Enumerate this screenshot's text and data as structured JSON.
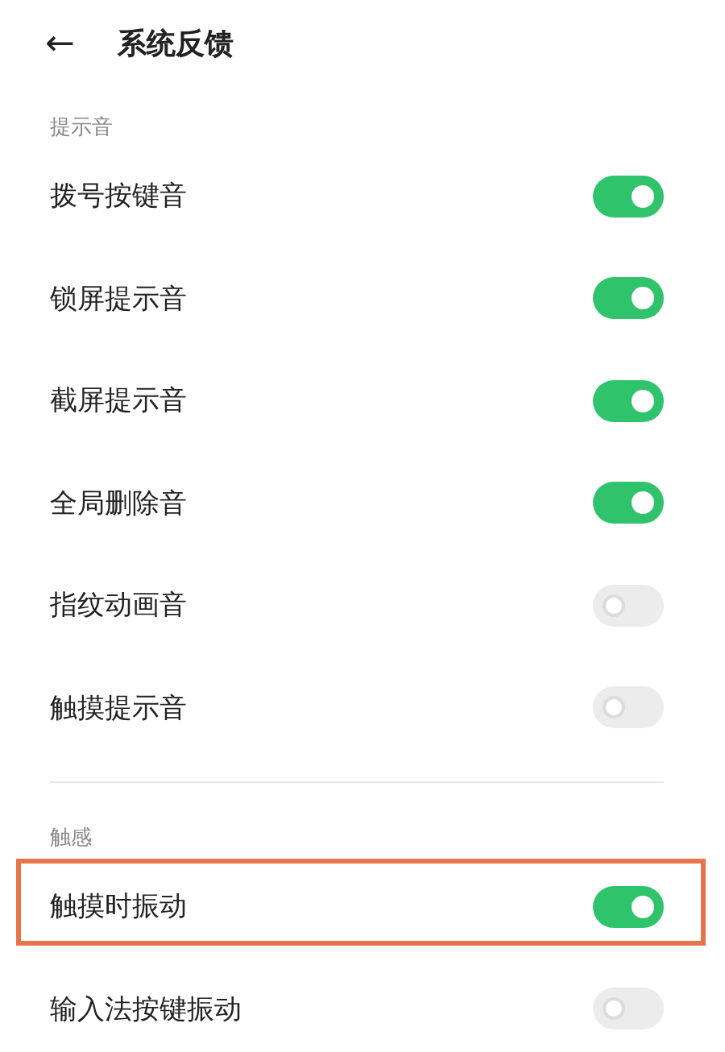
{
  "header": {
    "back": "←",
    "title": "系统反馈"
  },
  "sections": [
    {
      "label": "提示音",
      "rows": [
        {
          "label": "拨号按键音",
          "on": true,
          "highlighted": false
        },
        {
          "label": "锁屏提示音",
          "on": true,
          "highlighted": false
        },
        {
          "label": "截屏提示音",
          "on": true,
          "highlighted": false
        },
        {
          "label": "全局删除音",
          "on": true,
          "highlighted": false
        },
        {
          "label": "指纹动画音",
          "on": false,
          "highlighted": false
        },
        {
          "label": "触摸提示音",
          "on": false,
          "highlighted": false
        }
      ]
    },
    {
      "label": "触感",
      "rows": [
        {
          "label": "触摸时振动",
          "on": true,
          "highlighted": true
        },
        {
          "label": "输入法按键振动",
          "on": false,
          "highlighted": false
        }
      ]
    }
  ]
}
